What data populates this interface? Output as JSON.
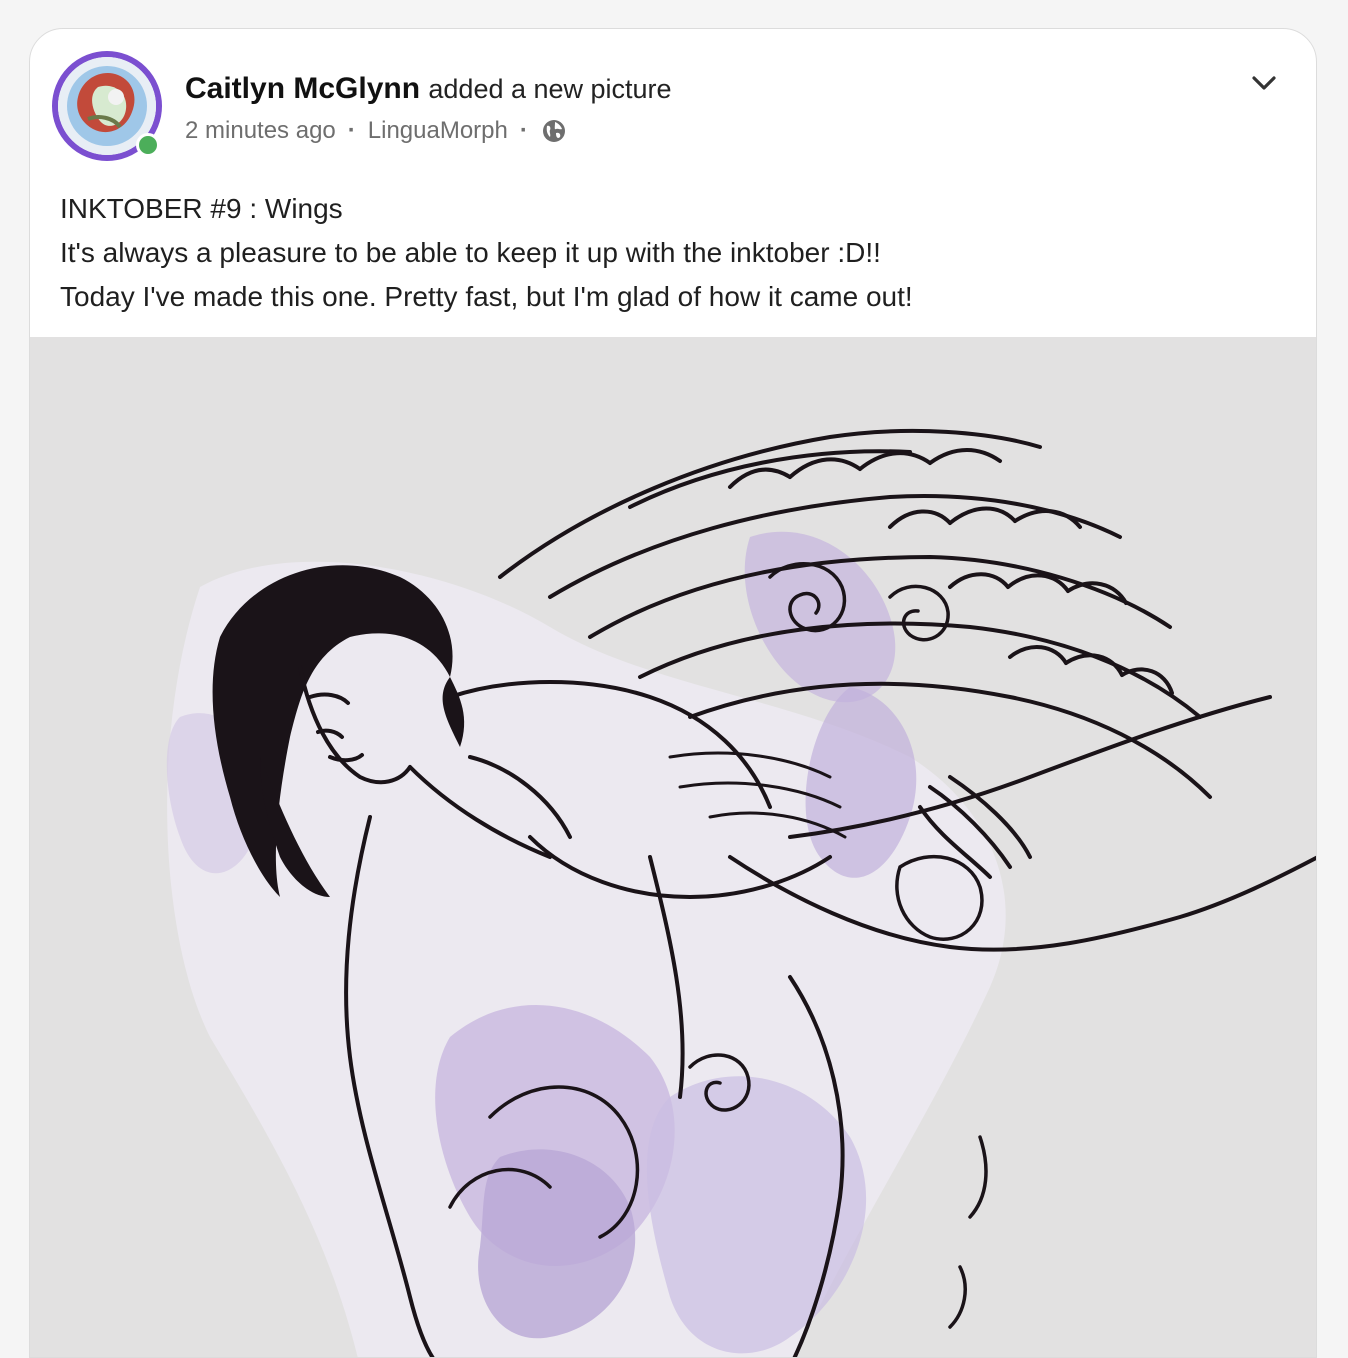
{
  "post": {
    "author": "Caitlyn McGlynn",
    "action": "added a new picture",
    "time": "2 minutes ago",
    "group": "LinguaMorph",
    "visibility_icon": "globe-icon",
    "menu_icon": "chevron-down-icon",
    "text_lines": [
      "INKTOBER #9 : Wings",
      "It's always a pleasure to be able to keep it up with the inktober :D!!",
      "Today I've made this one. Pretty fast, but I'm glad of how it came out!"
    ]
  },
  "colors": {
    "avatar_ring": "#7b4fd0",
    "online": "#4cae5a",
    "image_bg": "#e2e1e1",
    "ink": "#1a1318",
    "lavender": "#b9a8d6"
  }
}
